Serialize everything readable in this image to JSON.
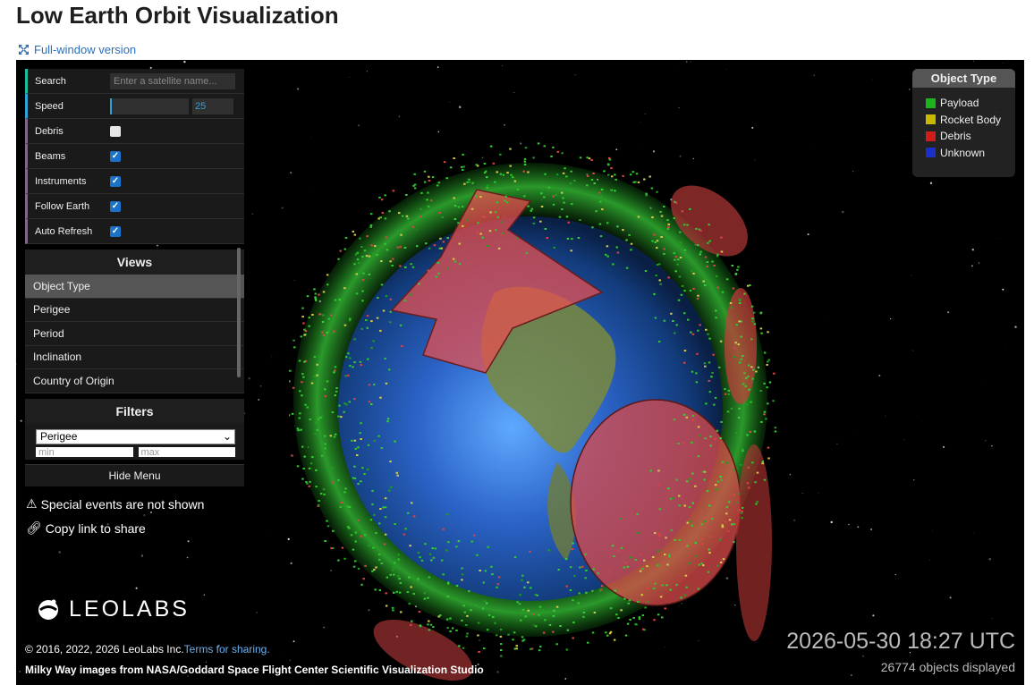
{
  "page": {
    "title": "Low Earth Orbit Visualization",
    "full_window_link": "Full-window version"
  },
  "controls": {
    "search_label": "Search",
    "search_placeholder": "Enter a satellite name...",
    "speed_label": "Speed",
    "speed_value": "25",
    "debris_label": "Debris",
    "debris_checked": false,
    "beams_label": "Beams",
    "beams_checked": true,
    "instruments_label": "Instruments",
    "instruments_checked": true,
    "follow_earth_label": "Follow Earth",
    "follow_earth_checked": true,
    "auto_refresh_label": "Auto Refresh",
    "auto_refresh_checked": true
  },
  "views": {
    "title": "Views",
    "items": [
      "Object Type",
      "Perigee",
      "Period",
      "Inclination",
      "Country of Origin"
    ],
    "active": "Object Type"
  },
  "filters": {
    "title": "Filters",
    "selected": "Perigee",
    "min_placeholder": "min",
    "max_placeholder": "max"
  },
  "hide_menu": "Hide Menu",
  "notes": {
    "special_events": "Special events are not shown",
    "copy_link": "Copy link to share"
  },
  "legend": {
    "title": "Object Type",
    "items": [
      {
        "label": "Payload",
        "color": "#1db31d"
      },
      {
        "label": "Rocket Body",
        "color": "#c9b800"
      },
      {
        "label": "Debris",
        "color": "#d21c1c"
      },
      {
        "label": "Unknown",
        "color": "#1c2fc9"
      }
    ]
  },
  "brand": {
    "logo_text": "LEOLABS"
  },
  "footer": {
    "copyright": "© 2016, 2022, 2026 LeoLabs Inc.",
    "terms_link": "Terms for sharing.",
    "credit": "Milky Way images from NASA/Goddard Space Flight Center Scientific Visualization Studio"
  },
  "status": {
    "timestamp": "2026-05-30 18:27 UTC",
    "objects_displayed": "26774 objects displayed"
  }
}
